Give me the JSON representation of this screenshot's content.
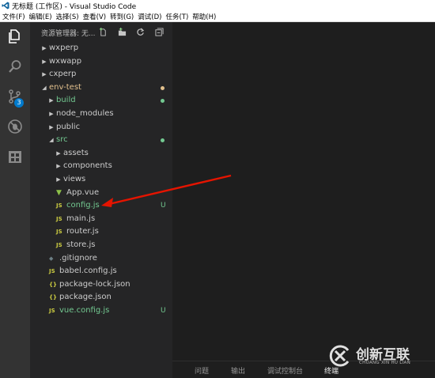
{
  "window": {
    "title": "无标题 (工作区) - Visual Studio Code"
  },
  "menu": [
    "文件(F)",
    "编辑(E)",
    "选择(S)",
    "查看(V)",
    "转到(G)",
    "调试(D)",
    "任务(T)",
    "帮助(H)"
  ],
  "activity": {
    "items": [
      "files-icon",
      "search-icon",
      "source-control-icon",
      "debug-icon",
      "extensions-icon"
    ],
    "scm_badge": "3"
  },
  "explorer": {
    "title": "资源管理器: 无...",
    "actions": [
      "new-file-icon",
      "new-folder-icon",
      "refresh-icon",
      "collapse-all-icon"
    ]
  },
  "tree": [
    {
      "name": "wxperp",
      "type": "folder",
      "expanded": false
    },
    {
      "name": "wxwapp",
      "type": "folder",
      "expanded": false
    },
    {
      "name": "cxperp",
      "type": "folder",
      "expanded": false
    },
    {
      "name": "env-test",
      "type": "folder",
      "expanded": true,
      "modified_dot": true
    },
    {
      "name": "build",
      "type": "folder",
      "expanded": false,
      "modified_dot": true
    },
    {
      "name": "node_modules",
      "type": "folder",
      "expanded": false
    },
    {
      "name": "public",
      "type": "folder",
      "expanded": false
    },
    {
      "name": "src",
      "type": "folder",
      "expanded": true,
      "modified_dot": true
    },
    {
      "name": "assets",
      "type": "folder",
      "expanded": false
    },
    {
      "name": "components",
      "type": "folder",
      "expanded": false
    },
    {
      "name": "views",
      "type": "folder",
      "expanded": false
    },
    {
      "name": "App.vue",
      "type": "vue"
    },
    {
      "name": "config.js",
      "type": "js",
      "status": "U"
    },
    {
      "name": "main.js",
      "type": "js"
    },
    {
      "name": "router.js",
      "type": "js"
    },
    {
      "name": "store.js",
      "type": "js"
    },
    {
      "name": ".gitignore",
      "type": "git"
    },
    {
      "name": "babel.config.js",
      "type": "js"
    },
    {
      "name": "package-lock.json",
      "type": "json"
    },
    {
      "name": "package.json",
      "type": "json"
    },
    {
      "name": "vue.config.js",
      "type": "js",
      "status": "U"
    }
  ],
  "panel": {
    "tabs": [
      "问题",
      "输出",
      "调试控制台",
      "终端"
    ],
    "active": "终端"
  },
  "colors": {
    "untracked": "#73c991",
    "modified_folder": "#e2c08d",
    "badge": "#007acc",
    "js_icon": "#cbcb41",
    "vue_icon": "#8dc149",
    "arrow": "#e51400"
  },
  "watermark": {
    "main": "创新互联",
    "sub": "CHUANG XIN HU LIAN"
  }
}
